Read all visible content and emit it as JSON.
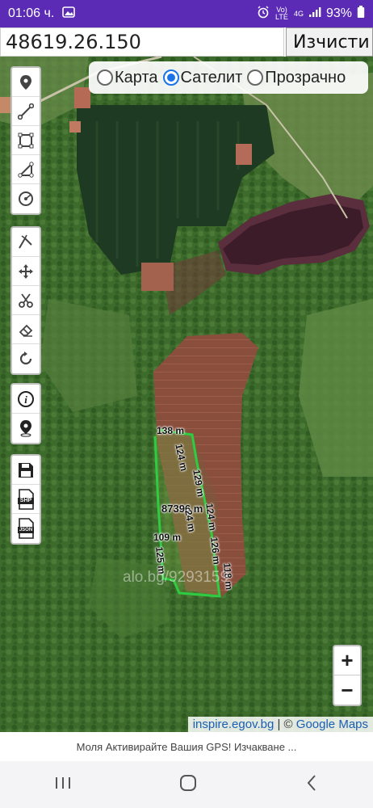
{
  "status_bar": {
    "time": "01:06 ч.",
    "signal_text": "Vo) LTE",
    "network": "4G",
    "battery": "93%"
  },
  "topbar": {
    "coordinate_value": "48619.26.150",
    "clear_label": "Изчисти"
  },
  "layers": {
    "options": [
      {
        "label": "Карта",
        "selected": false
      },
      {
        "label": "Сателит",
        "selected": true
      },
      {
        "label": "Прозрачно",
        "selected": false
      }
    ]
  },
  "toolbar": {
    "group1": [
      "marker-icon",
      "line-icon",
      "rectangle-icon",
      "polyline-icon",
      "circle-icon"
    ],
    "group2": [
      "cut-polygon-icon",
      "move-icon",
      "scissors-icon",
      "eraser-icon",
      "rotate-icon"
    ],
    "group3": [
      "info-icon",
      "gps-location-icon"
    ],
    "group4": [
      "save-icon",
      "shp-file-icon",
      "json-file-icon"
    ],
    "shp_label": "SHP",
    "json_label": "JSON"
  },
  "measurements": {
    "top": "138 m",
    "right1": "124 m",
    "right2": "129 m",
    "area": "87396 m",
    "right3": "124 m",
    "inner": "24 m",
    "right4": "126 m",
    "right5": "118 m",
    "left_mid": "109 m",
    "left_low": "125 m"
  },
  "watermark": "alo.bg/9293159",
  "attribution": {
    "source": "inspire.egov.bg",
    "separator": " | © ",
    "provider": "Google Maps"
  },
  "zoom": {
    "in": "+",
    "out": "−"
  },
  "footer_message": "Моля Активирайте Вашия GPS! Изчакване ...",
  "colors": {
    "accent": "#1a73e8",
    "statusbar": "#5b2bb5",
    "polygon": "#2ecc40"
  }
}
